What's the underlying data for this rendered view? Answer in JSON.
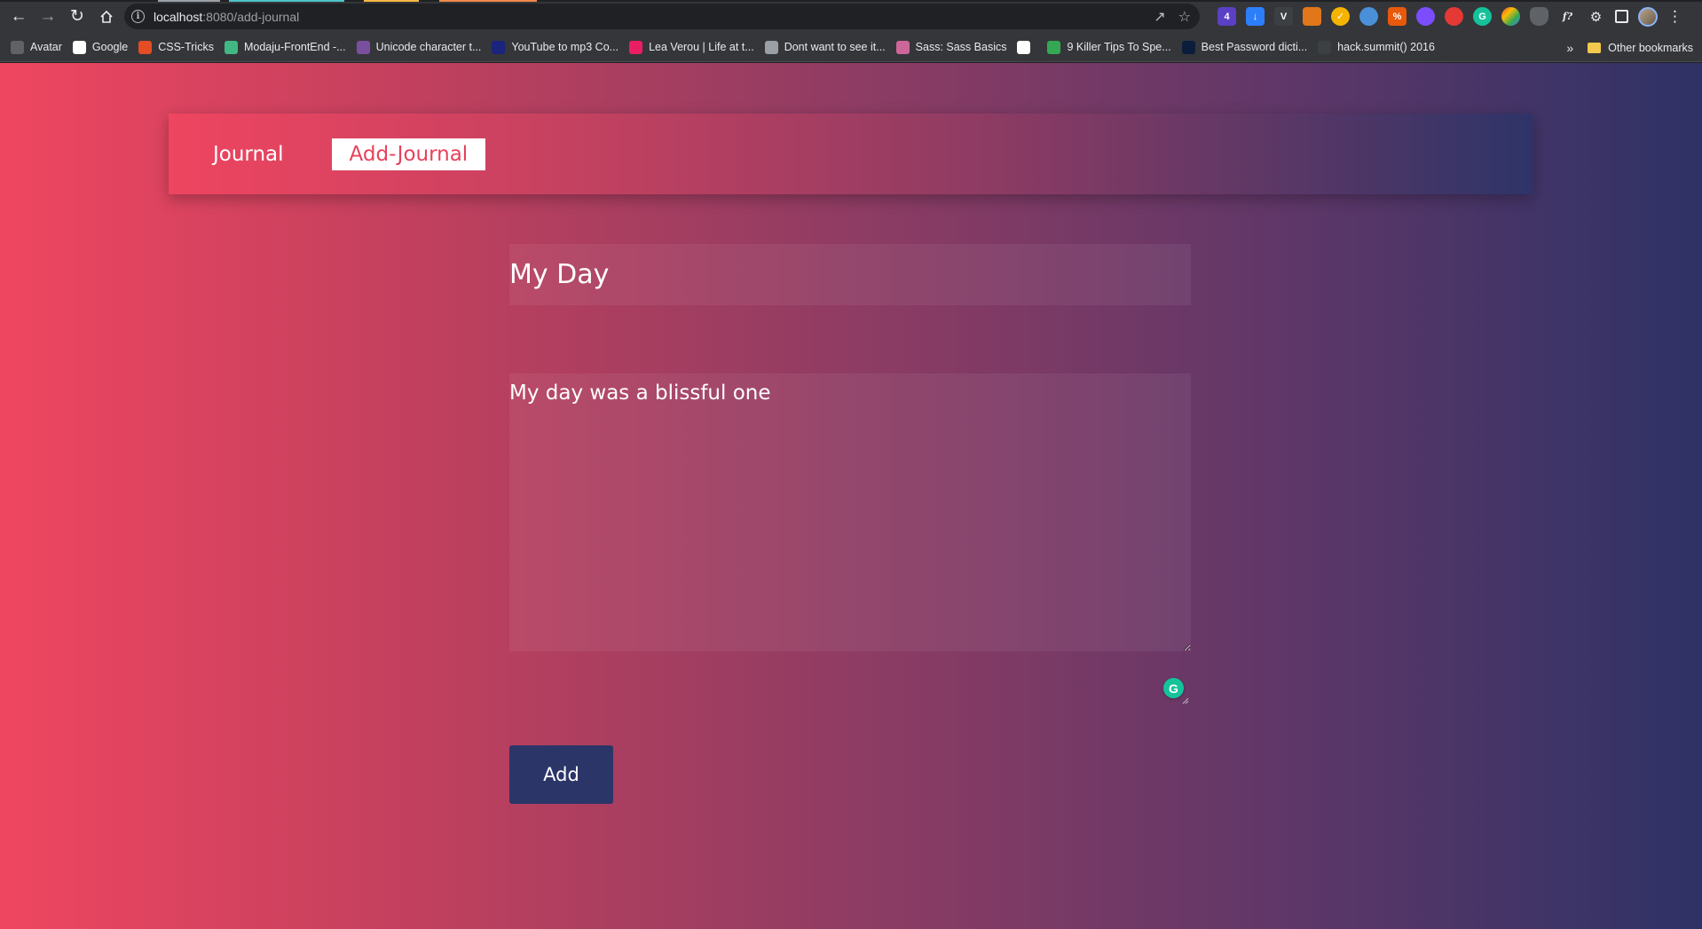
{
  "browser": {
    "url_host": "localhost",
    "url_path": ":8080/add-journal",
    "bookmarks": [
      {
        "label": "Avatar",
        "icon": "github-icon",
        "color": "#5f6368"
      },
      {
        "label": "Google",
        "icon": "google-icon",
        "color": "#ffffff"
      },
      {
        "label": "CSS-Tricks",
        "icon": "css-tricks-icon",
        "color": "#e44d26"
      },
      {
        "label": "Modaju-FrontEnd -...",
        "icon": "vue-icon",
        "color": "#41b883"
      },
      {
        "label": "Unicode character t...",
        "icon": "unicode-table-icon",
        "color": "#7b4fa0"
      },
      {
        "label": "YouTube to mp3 Co...",
        "icon": "youtube-mp3-icon",
        "color": "#1a237e"
      },
      {
        "label": "Lea Verou | Life at t...",
        "icon": "lea-verou-icon",
        "color": "#e91e63"
      },
      {
        "label": "Dont want to see it...",
        "icon": "incognito-icon",
        "color": "#9aa0a6"
      },
      {
        "label": "Sass: Sass Basics",
        "icon": "sass-icon",
        "color": "#cd6799"
      },
      {
        "label": "",
        "icon": "blank-page-icon",
        "color": "#ffffff"
      },
      {
        "label": "9 Killer Tips To Spe...",
        "icon": "tips-icon",
        "color": "#34a853"
      },
      {
        "label": "Best Password dicti...",
        "icon": "password-dictionary-icon",
        "color": "#0b1d3a"
      },
      {
        "label": "hack.summit() 2016",
        "icon": "hack-summit-icon",
        "color": "#3c4043"
      }
    ],
    "other_bookmarks": "Other bookmarks"
  },
  "nav": {
    "journal": "Journal",
    "add_journal": "Add-Journal"
  },
  "form": {
    "title_value": "My Day",
    "body_value": "My day was a blissful one",
    "add_label": "Add"
  },
  "colors": {
    "gradient_start": "#ef4660",
    "gradient_end": "#2e3266",
    "button": "#2b3568",
    "active_link_text": "#e8415c"
  }
}
